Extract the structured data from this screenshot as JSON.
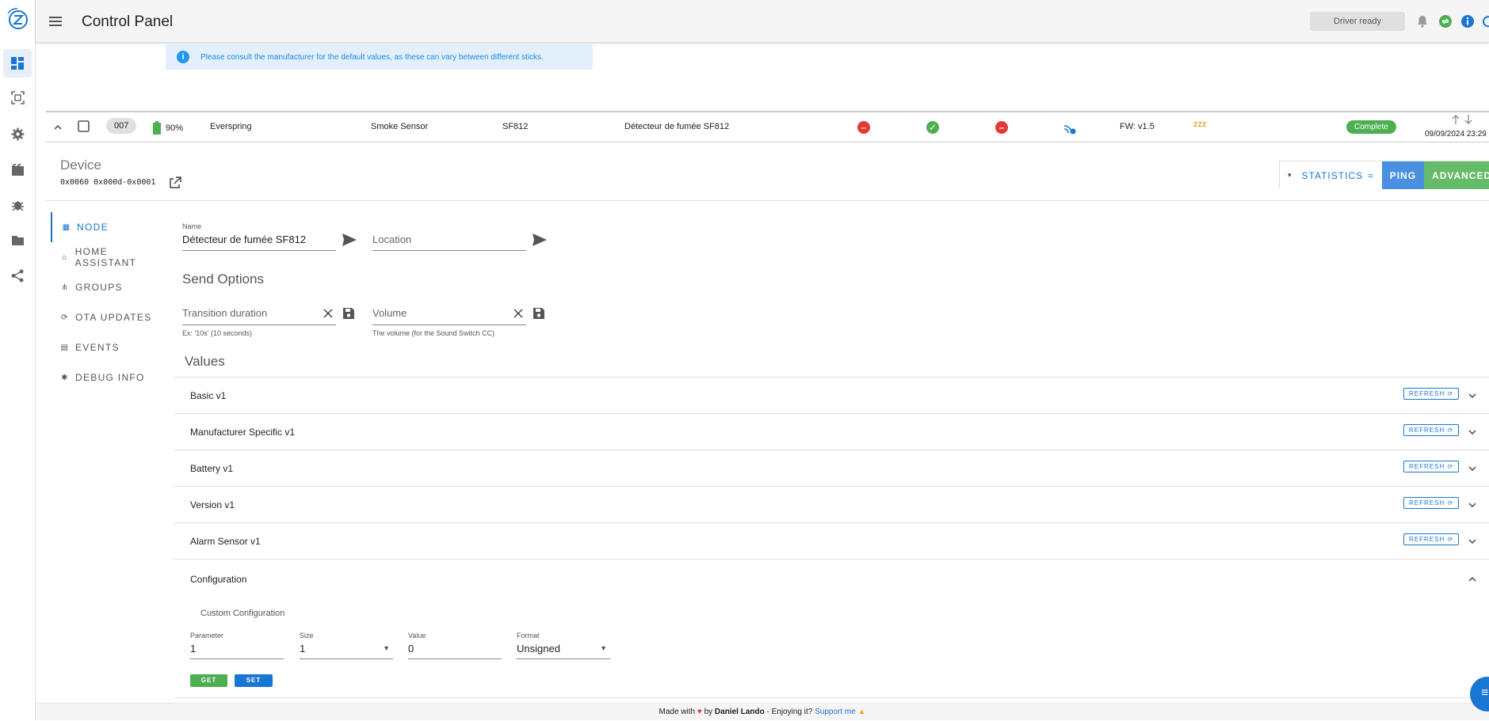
{
  "header": {
    "title": "Control Panel",
    "driver_status": "Driver ready"
  },
  "alert": {
    "text": "Please consult the manufacturer for the default values, as these can vary between different sticks."
  },
  "node_row": {
    "id": "007",
    "battery": "90%",
    "manufacturer": "Everspring",
    "product": "Smoke Sensor",
    "model": "SF812",
    "name": "Détecteur de fumée SF812",
    "firmware": "FW: v1.5",
    "sleep": "zzz",
    "interview": "Complete",
    "last_active": "09/09/2024 23:29"
  },
  "device": {
    "label": "Device",
    "id": "0x0060 0x000d-0x0001"
  },
  "actions": {
    "statistics": "STATISTICS",
    "ping": "PING",
    "advanced": "ADVANCED"
  },
  "tabs": [
    {
      "label": "NODE",
      "icon": "grid-icon"
    },
    {
      "label": "HOME ASSISTANT",
      "icon": "home-icon"
    },
    {
      "label": "GROUPS",
      "icon": "groups-icon"
    },
    {
      "label": "OTA UPDATES",
      "icon": "update-icon"
    },
    {
      "label": "EVENTS",
      "icon": "events-icon"
    },
    {
      "label": "DEBUG INFO",
      "icon": "bug-icon"
    }
  ],
  "node_form": {
    "name_label": "Name",
    "name_value": "Détecteur de fumée SF812",
    "location_placeholder": "Location",
    "send_options_title": "Send Options",
    "transition_placeholder": "Transition duration",
    "transition_hint": "Ex: '10s' (10 seconds)",
    "volume_placeholder": "Volume",
    "volume_hint": "The volume (for the Sound Switch CC)",
    "values_title": "Values"
  },
  "command_classes": [
    {
      "label": "Basic v1",
      "refresh": "REFRESH"
    },
    {
      "label": "Manufacturer Specific v1",
      "refresh": "REFRESH"
    },
    {
      "label": "Battery v1",
      "refresh": "REFRESH"
    },
    {
      "label": "Version v1",
      "refresh": "REFRESH"
    },
    {
      "label": "Alarm Sensor v1",
      "refresh": "REFRESH"
    }
  ],
  "configuration": {
    "title": "Configuration",
    "subtitle": "Custom Configuration",
    "parameter_label": "Parameter",
    "parameter_value": "1",
    "size_label": "Size",
    "size_value": "1",
    "value_label": "Value",
    "value_value": "0",
    "format_label": "Format",
    "format_value": "Unsigned",
    "get_label": "GET",
    "set_label": "SET"
  },
  "footer": {
    "made_with": "Made with",
    "by": "by",
    "author": "Daniel Lando",
    "enjoying": "- Enjoying it?",
    "support": "Support me"
  },
  "colors": {
    "primary": "#1976d2",
    "success": "#4caf50",
    "error": "#e53935",
    "warning": "#f9a825"
  }
}
